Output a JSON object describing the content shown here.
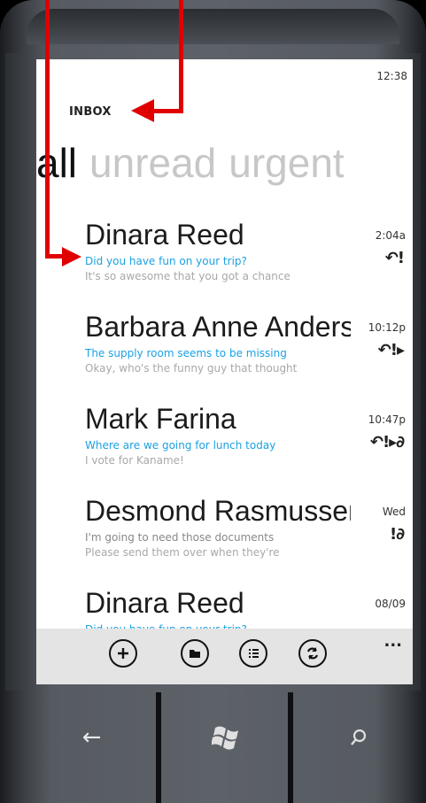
{
  "status": {
    "time": "12:38"
  },
  "header": {
    "title": "INBOX"
  },
  "pivots": [
    {
      "label": "all",
      "active": true
    },
    {
      "label": "unread",
      "active": false
    },
    {
      "label": "urgent",
      "active": false
    }
  ],
  "messages": [
    {
      "sender": "Dinara Reed",
      "subject": "Did you have fun on your trip?",
      "preview": "It's so awesome that you got a chance",
      "time": "2:04a",
      "flags": "↶!"
    },
    {
      "sender": "Barbara Anne Anderson",
      "subject": "The supply room seems to be missing",
      "preview": "Okay, who's the funny guy that thought",
      "time": "10:12p",
      "flags": "↶!▸"
    },
    {
      "sender": "Mark Farina",
      "subject": "Where are we going for lunch today",
      "preview": "I vote for Kaname!",
      "time": "10:47p",
      "flags": "↶!▸∂"
    },
    {
      "sender": "Desmond Rasmussen",
      "subject": "I'm going to need those documents",
      "preview": "Please send them over when they're",
      "time": "Wed",
      "flags": "!∂"
    },
    {
      "sender": "Dinara Reed",
      "subject": "Did you have fun on your trip?",
      "preview": "",
      "time": "08/09",
      "flags": ""
    }
  ],
  "appbar": {
    "buttons": [
      {
        "name": "new-message",
        "icon": "plus-icon"
      },
      {
        "name": "select-folder",
        "icon": "folder-icon"
      },
      {
        "name": "select-messages",
        "icon": "list-icon"
      },
      {
        "name": "sync",
        "icon": "sync-icon"
      }
    ],
    "more": "..."
  },
  "hardware": {
    "back": "←",
    "search": "⌕"
  },
  "colors": {
    "accent": "#1ba1e2",
    "annotation": "#e00000",
    "appbar": "#e4e4e4"
  }
}
